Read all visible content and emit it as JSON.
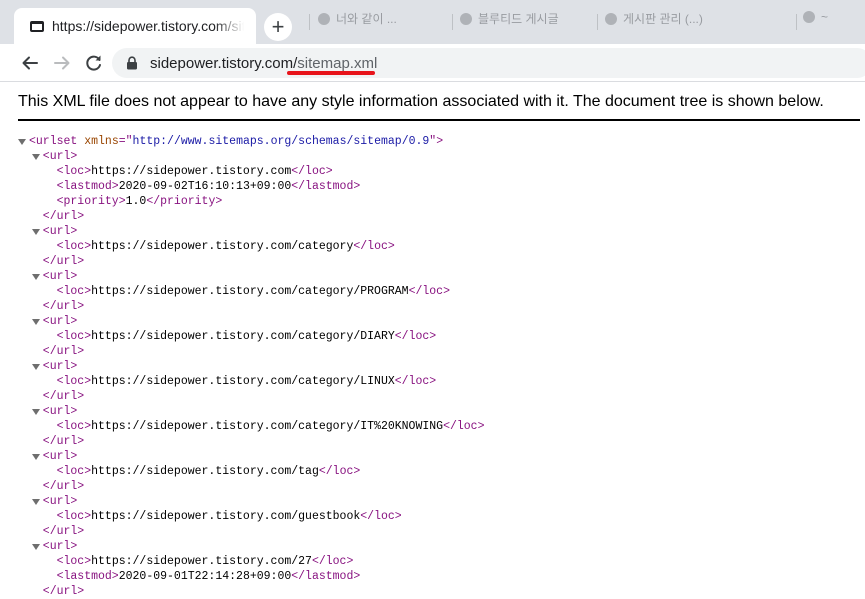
{
  "browser": {
    "active_tab": {
      "title": "https://sidepower.tistory.com/sitemap.xml",
      "favicon": "page-favicon-icon"
    },
    "new_tab_label": "+",
    "background_tabs": [
      "너와 같이 ...",
      "블루티드 게시글",
      "게시판 관리 (...)",
      "~"
    ],
    "url": {
      "host": "sidepower.tistory.com/",
      "path": "sitemap.xml"
    },
    "highlight_color": "#e8141b"
  },
  "xml_view": {
    "info_message": "This XML file does not appear to have any style information associated with it. The document tree is shown below.",
    "root": {
      "tag": "urlset",
      "attr_name": "xmlns",
      "attr_value": "http://www.sitemaps.org/schemas/sitemap/0.9"
    },
    "entries": [
      {
        "loc": "https://sidepower.tistory.com",
        "lastmod": "2020-09-02T16:10:13+09:00",
        "priority": "1.0"
      },
      {
        "loc": "https://sidepower.tistory.com/category"
      },
      {
        "loc": "https://sidepower.tistory.com/category/PROGRAM"
      },
      {
        "loc": "https://sidepower.tistory.com/category/DIARY"
      },
      {
        "loc": "https://sidepower.tistory.com/category/LINUX"
      },
      {
        "loc": "https://sidepower.tistory.com/category/IT%20KNOWING"
      },
      {
        "loc": "https://sidepower.tistory.com/tag"
      },
      {
        "loc": "https://sidepower.tistory.com/guestbook"
      },
      {
        "loc": "https://sidepower.tistory.com/27",
        "lastmod": "2020-09-01T22:14:28+09:00"
      }
    ]
  }
}
